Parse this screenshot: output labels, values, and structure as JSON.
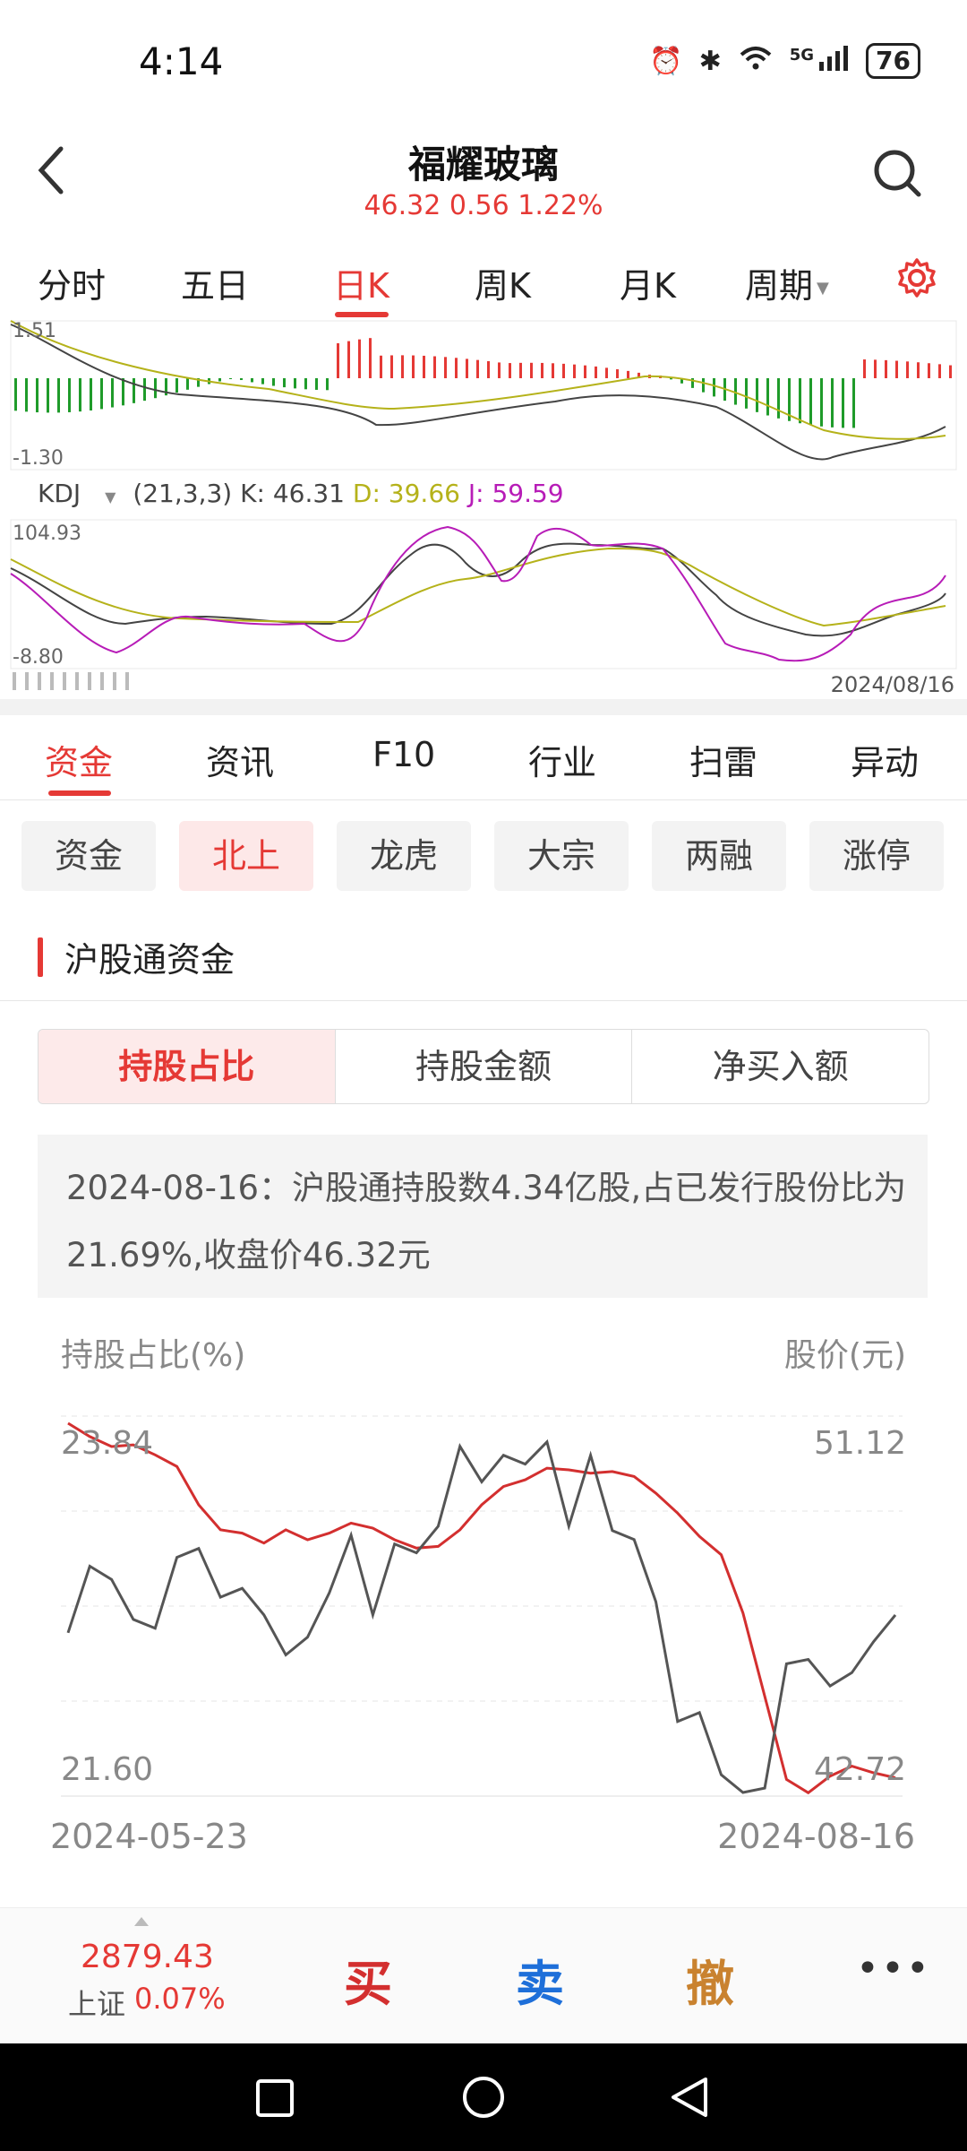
{
  "status_bar": {
    "time": "4:14",
    "network": "5G",
    "battery": "76"
  },
  "header": {
    "title": "福耀玻璃",
    "price": "46.32",
    "change": "0.56",
    "change_pct": "1.22%"
  },
  "period_tabs": [
    "分时",
    "五日",
    "日K",
    "周K",
    "月K",
    "周期"
  ],
  "active_period": "日K",
  "macd_panel": {
    "top_label": "1.51",
    "bottom_label": "-1.30"
  },
  "kdj": {
    "name": "KDJ",
    "params": "(21,3,3)",
    "k_text": "K: 46.31",
    "d_text": "D: 39.66",
    "j_text": "J: 59.59",
    "top_label": "104.93",
    "bottom_label": "-8.80",
    "date": "2024/08/16"
  },
  "section_tabs": [
    "资金",
    "资讯",
    "F10",
    "行业",
    "扫雷",
    "异动"
  ],
  "active_section": "资金",
  "sub_tabs": [
    "资金",
    "北上",
    "龙虎",
    "大宗",
    "两融",
    "涨停"
  ],
  "active_sub": "北上",
  "section_title": "沪股通资金",
  "segmented": [
    "持股占比",
    "持股金额",
    "净买入额"
  ],
  "active_segment": "持股占比",
  "info_text": "2024-08-16：沪股通持股数4.34亿股,占已发行股份比为21.69%,收盘价46.32元",
  "chart_data": {
    "type": "line",
    "ylabel_left": "持股占比(%)",
    "ylabel_right": "股价(元)",
    "y_left_range": [
      21.6,
      23.84
    ],
    "y_right_range": [
      42.72,
      51.12
    ],
    "y_left_labels": [
      "23.84",
      "21.60"
    ],
    "y_right_labels": [
      "51.12",
      "42.72"
    ],
    "x_labels": [
      "2024-05-23",
      "2024-08-16"
    ],
    "series": [
      {
        "color": "#d32f2f",
        "axis": "left",
        "values": [
          23.84,
          23.76,
          23.7,
          23.71,
          23.65,
          23.58,
          23.35,
          23.2,
          23.18,
          23.12,
          23.2,
          23.14,
          23.18,
          23.24,
          23.21,
          23.14,
          23.09,
          23.1,
          23.2,
          23.35,
          23.46,
          23.5,
          23.57,
          23.56,
          23.54,
          23.55,
          23.52,
          23.42,
          23.3,
          23.16,
          23.05,
          22.7,
          22.2,
          21.7,
          21.62,
          21.72,
          21.78,
          21.74,
          21.71
        ]
      },
      {
        "color": "#555555",
        "axis": "right",
        "values": [
          46.4,
          47.9,
          47.6,
          46.7,
          46.5,
          48.1,
          48.3,
          47.2,
          47.4,
          46.8,
          45.9,
          46.3,
          47.3,
          48.6,
          46.8,
          48.4,
          48.2,
          48.8,
          50.6,
          49.8,
          50.4,
          50.2,
          50.7,
          48.8,
          50.4,
          48.7,
          48.5,
          47.1,
          44.4,
          44.6,
          43.2,
          42.8,
          42.9,
          45.7,
          45.8,
          45.2,
          45.5,
          46.2,
          46.8
        ]
      }
    ]
  },
  "bottom_bar": {
    "index_value": "2879.43",
    "index_name": "上证",
    "index_change": "0.07%",
    "buy": "买",
    "sell": "卖",
    "cancel": "撤",
    "more": "•••"
  }
}
